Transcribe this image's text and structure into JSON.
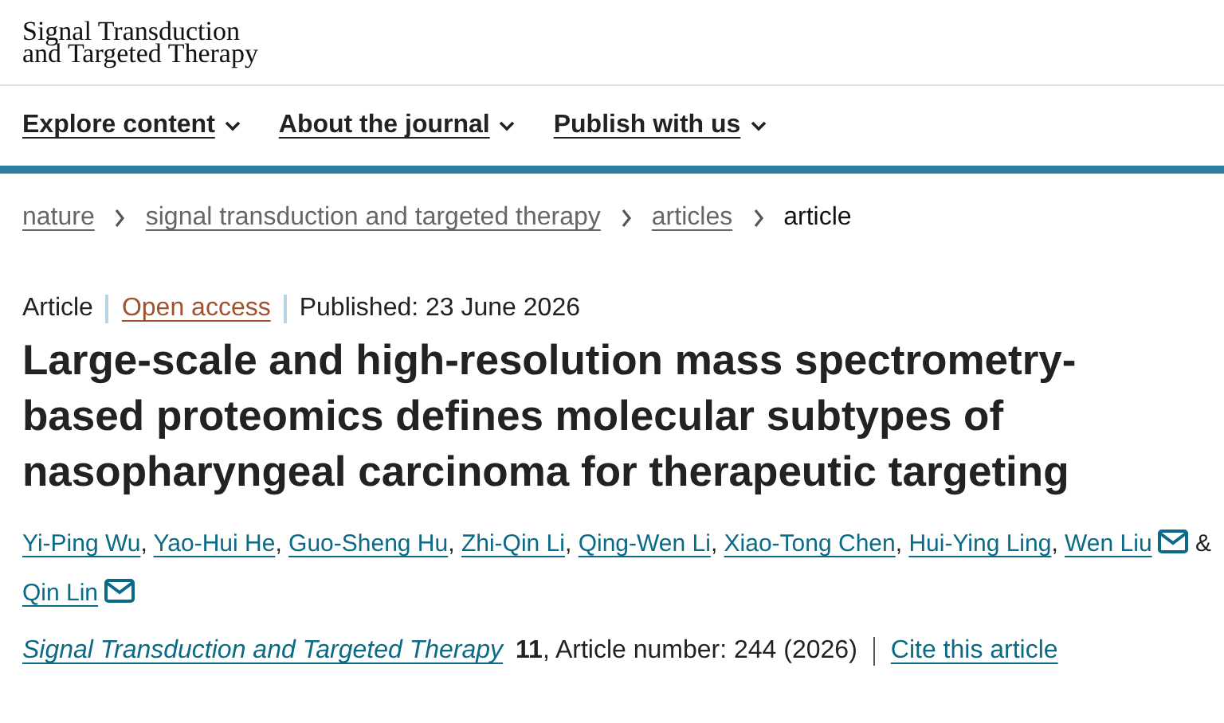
{
  "journal_logo": {
    "line_1": "Signal Transduction",
    "line_2": "and Targeted Therapy"
  },
  "nav": [
    {
      "label": "Explore content",
      "dropdown": true
    },
    {
      "label": "About the journal",
      "dropdown": true
    },
    {
      "label": "Publish with us",
      "dropdown": true
    }
  ],
  "breadcrumbs": [
    {
      "label": "nature",
      "link": true
    },
    {
      "label": "signal transduction and targeted therapy",
      "link": true
    },
    {
      "label": "articles",
      "link": true
    },
    {
      "label": "article",
      "link": false
    }
  ],
  "article": {
    "type": "Article",
    "access": "Open access",
    "published": "Published: 23 June 2026",
    "title": "Large-scale and high-resolution mass spectrometry-based proteomics defines molecular subtypes of nasopharyngeal carcinoma for therapeutic targeting",
    "authors": [
      {
        "name": "Yi-Ping Wu",
        "email": false,
        "after": ","
      },
      {
        "name": "Yao-Hui He",
        "email": false,
        "after": ","
      },
      {
        "name": "Guo-Sheng Hu",
        "email": false,
        "after": ","
      },
      {
        "name": "Zhi-Qin Li",
        "email": false,
        "after": ","
      },
      {
        "name": "Qing-Wen Li",
        "email": false,
        "after": ","
      },
      {
        "name": "Xiao-Tong Chen",
        "email": false,
        "after": ","
      },
      {
        "name": "Hui-Ying Ling",
        "email": false,
        "after": ","
      },
      {
        "name": "Wen Liu",
        "email": true,
        "after": "&"
      },
      {
        "name": "Qin Lin",
        "email": true
      }
    ],
    "journal": "Signal Transduction and Targeted Therapy",
    "volume": "11",
    "article_number": ", Article number: 244 (2026)",
    "cite": "Cite this article"
  }
}
